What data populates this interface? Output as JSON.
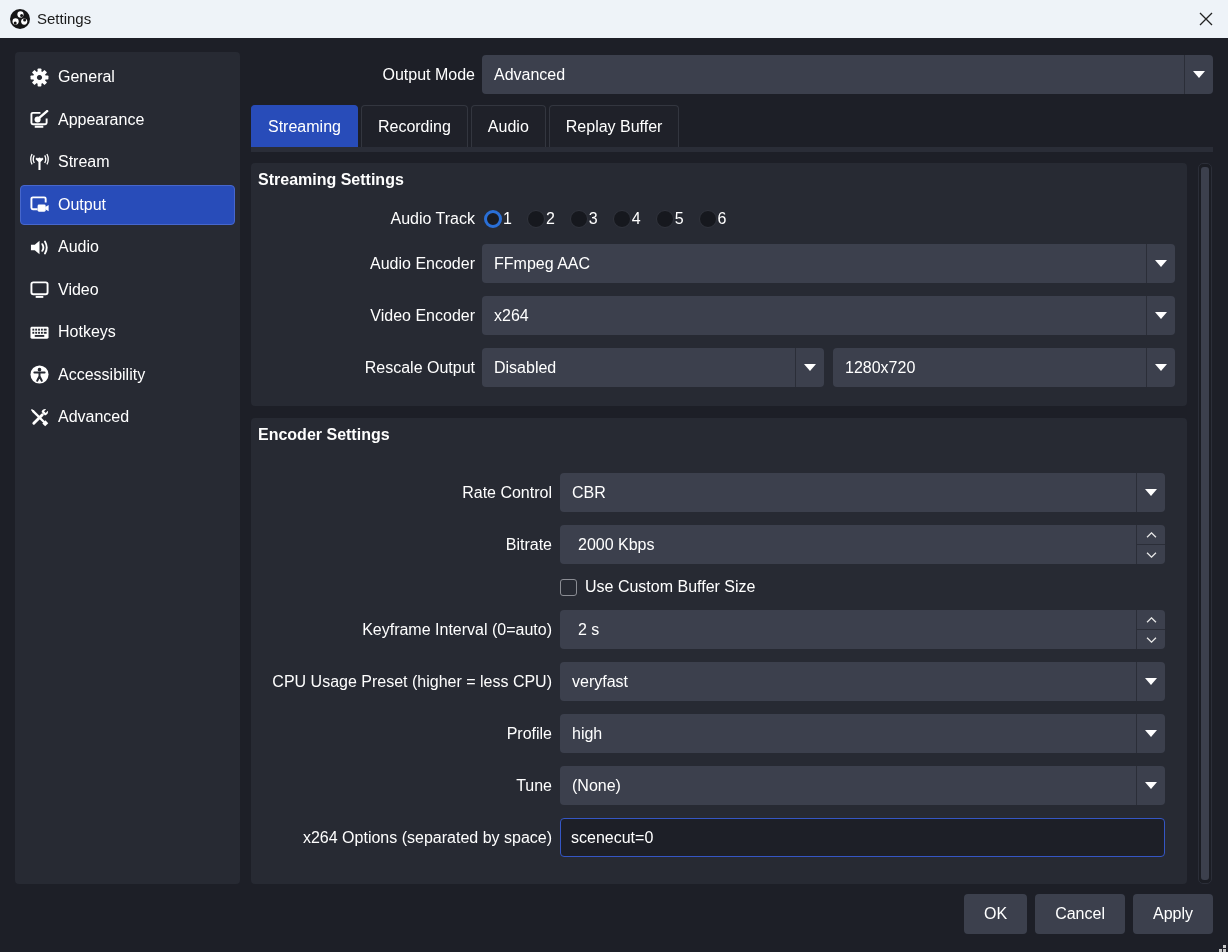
{
  "window": {
    "title": "Settings"
  },
  "sidebar": {
    "items": [
      {
        "label": "General",
        "selected": false
      },
      {
        "label": "Appearance",
        "selected": false
      },
      {
        "label": "Stream",
        "selected": false
      },
      {
        "label": "Output",
        "selected": true
      },
      {
        "label": "Audio",
        "selected": false
      },
      {
        "label": "Video",
        "selected": false
      },
      {
        "label": "Hotkeys",
        "selected": false
      },
      {
        "label": "Accessibility",
        "selected": false
      },
      {
        "label": "Advanced",
        "selected": false
      }
    ]
  },
  "output_mode": {
    "label": "Output Mode",
    "value": "Advanced"
  },
  "tabs": [
    {
      "label": "Streaming",
      "selected": true
    },
    {
      "label": "Recording",
      "selected": false
    },
    {
      "label": "Audio",
      "selected": false
    },
    {
      "label": "Replay Buffer",
      "selected": false
    }
  ],
  "streaming_settings": {
    "title": "Streaming Settings",
    "rows": [
      {
        "kind": "radios",
        "label": "Audio Track",
        "options": [
          {
            "label": "1",
            "selected": true
          },
          {
            "label": "2",
            "selected": false
          },
          {
            "label": "3",
            "selected": false
          },
          {
            "label": "4",
            "selected": false
          },
          {
            "label": "5",
            "selected": false
          },
          {
            "label": "6",
            "selected": false
          }
        ]
      },
      {
        "kind": "dropdown",
        "label": "Audio Encoder",
        "values": [
          "FFmpeg AAC"
        ]
      },
      {
        "kind": "dropdown",
        "label": "Video Encoder",
        "values": [
          "x264"
        ]
      },
      {
        "kind": "dropdown",
        "label": "Rescale Output",
        "values": [
          "Disabled",
          "1280x720"
        ]
      }
    ]
  },
  "encoder_settings": {
    "title": "Encoder Settings",
    "rows": [
      {
        "kind": "dropdown",
        "label": "Rate Control",
        "values": [
          "CBR"
        ]
      },
      {
        "kind": "spin",
        "label": "Bitrate",
        "value": "2000 Kbps"
      },
      {
        "kind": "checkbox",
        "label": "Use Custom Buffer Size",
        "checked": false
      },
      {
        "kind": "spin",
        "label": "Keyframe Interval (0=auto)",
        "value": "2 s"
      },
      {
        "kind": "dropdown",
        "label": "CPU Usage Preset (higher = less CPU)",
        "values": [
          "veryfast"
        ]
      },
      {
        "kind": "dropdown",
        "label": "Profile",
        "values": [
          "high"
        ]
      },
      {
        "kind": "dropdown",
        "label": "Tune",
        "values": [
          "(None)"
        ]
      },
      {
        "kind": "text",
        "label": "x264 Options (separated by space)",
        "value": "scenecut=0",
        "focused": true
      }
    ]
  },
  "buttons": [
    {
      "label": "OK"
    },
    {
      "label": "Cancel"
    },
    {
      "label": "Apply"
    }
  ]
}
